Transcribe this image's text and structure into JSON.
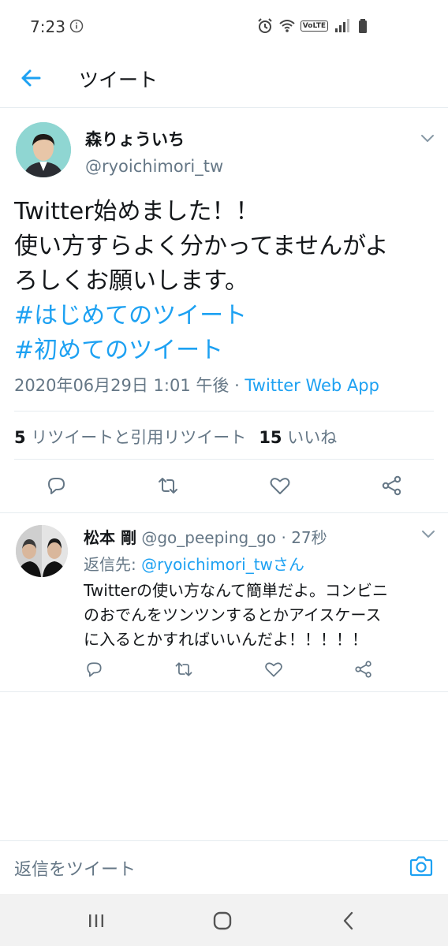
{
  "status_bar": {
    "time": "7:23",
    "volte_label": "VoLTE",
    "icons": [
      "info-icon",
      "alarm-icon",
      "wifi-icon",
      "signal-icon",
      "battery-icon"
    ]
  },
  "header": {
    "title": "ツイート",
    "back_icon": "arrow-left-icon"
  },
  "main_tweet": {
    "name": "森りょういち",
    "handle": "@ryoichimori_tw",
    "text_lines": [
      "Twitter始めました！！",
      "使い方すらよく分かってませんがよ",
      "ろしくお願いします。"
    ],
    "hashtags": [
      "#はじめてのツイート",
      "#初めてのツイート"
    ],
    "timestamp": "2020年06月29日 1:01 午後 · ",
    "source": "Twitter Web App",
    "retweet_count": "5",
    "retweet_label": " リツイートと引用リツイート",
    "like_count": "15",
    "like_label": " いいね"
  },
  "reply_tweet": {
    "name": "松本 剛",
    "handle": " @go_peeping_go",
    "time": " · 27秒",
    "reply_to_label": "返信先: ",
    "reply_to_mention": "@ryoichimori_twさん",
    "text_lines": [
      "Twitterの使い方なんて簡単だよ。コンビニ",
      "のおでんをツンツンするとかアイスケース",
      "に入るとかすればいいんだよ！！！！！"
    ]
  },
  "compose": {
    "placeholder": "返信をツイート"
  },
  "colors": {
    "accent": "#1da1f2",
    "secondary_text": "#657786",
    "primary_text": "#14171a",
    "divider": "#e6ecf0"
  }
}
